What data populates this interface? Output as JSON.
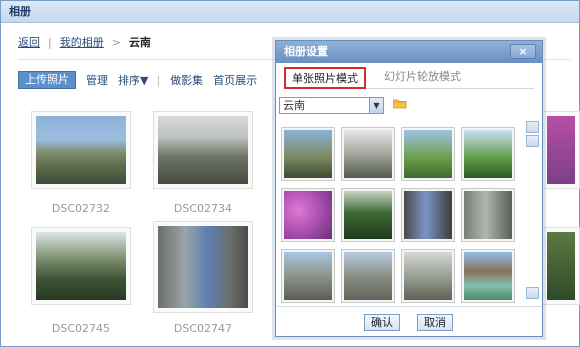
{
  "window": {
    "title": "相册"
  },
  "breadcrumb": {
    "back": "返回",
    "separator": "|",
    "album_link": "我的相册",
    "arrow": ">",
    "current": "云南"
  },
  "toolbar": {
    "upload": "上传照片",
    "manage": "管理",
    "sort": "排序▼",
    "slideshow": "做影集",
    "homepage": "首页展示"
  },
  "photos": [
    {
      "caption": "DSC02732"
    },
    {
      "caption": "DSC02734"
    },
    {
      "caption": "DSC02745"
    },
    {
      "caption": "DSC02747"
    }
  ],
  "dialog": {
    "title": "相册设置",
    "close": "×",
    "tabs": [
      {
        "label": "单张照片模式",
        "active": true
      },
      {
        "label": "幻灯片轮放模式",
        "active": false
      }
    ],
    "album_select": {
      "value": "云南"
    },
    "ok": "确认",
    "cancel": "取消"
  },
  "colors": {
    "accent": "#d62a2a",
    "brand": "#5d8fc8"
  }
}
